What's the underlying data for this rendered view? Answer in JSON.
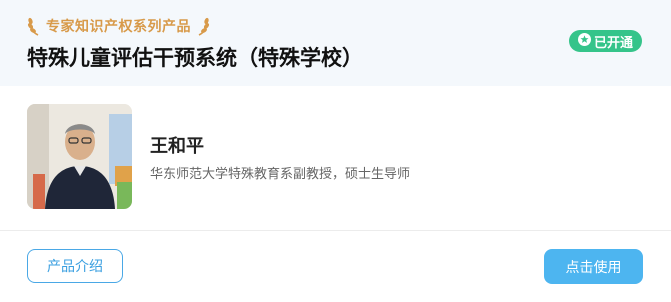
{
  "header": {
    "badge_text": "专家知识产权系列产品",
    "title": "特殊儿童评估干预系统（特殊学校）",
    "status_label": "已开通"
  },
  "expert": {
    "name": "王和平",
    "description": "华东师范大学特殊教育系副教授，硕士生导师"
  },
  "actions": {
    "intro_label": "产品介绍",
    "use_label": "点击使用"
  },
  "colors": {
    "accent_blue": "#4db5f0",
    "status_green": "#35c48a",
    "badge_gold": "#d89a4a"
  },
  "icons": {
    "laurel": "laurel-icon",
    "status": "star-icon"
  }
}
